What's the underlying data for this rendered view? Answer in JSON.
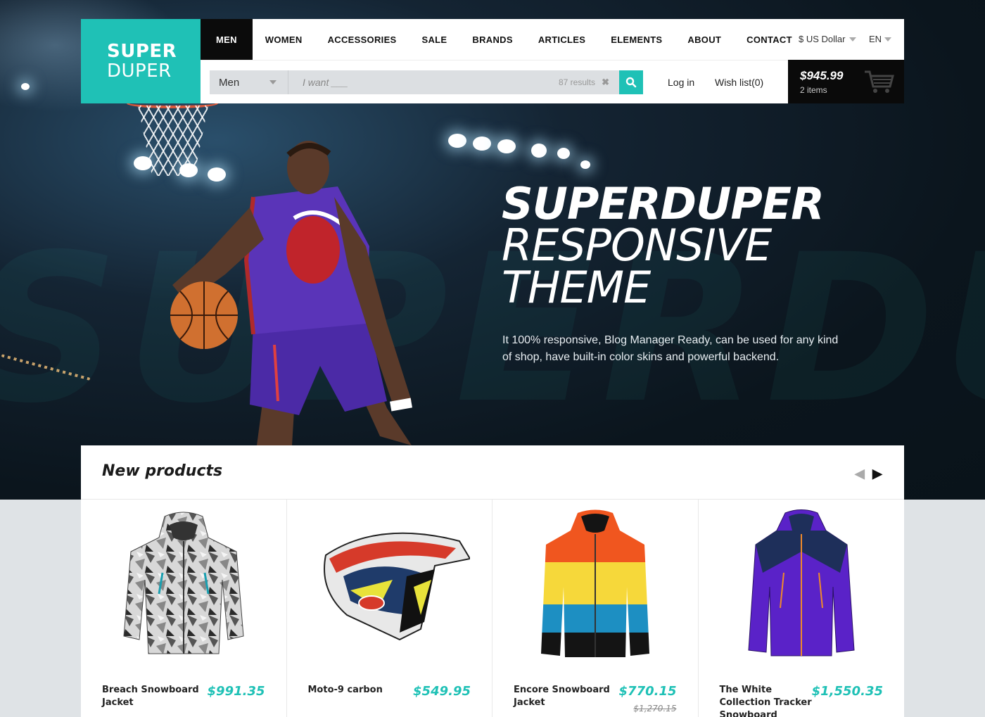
{
  "brand": {
    "line1": "SUPER",
    "line2": "DUPER"
  },
  "nav": {
    "items": [
      "MEN",
      "WOMEN",
      "ACCESSORIES",
      "SALE",
      "BRANDS",
      "ARTICLES",
      "ELEMENTS",
      "ABOUT",
      "CONTACT"
    ],
    "active": "MEN"
  },
  "currency": {
    "label": "$ US Dollar"
  },
  "language": {
    "label": "EN"
  },
  "search": {
    "category": "Men",
    "placeholder": "I want ___",
    "results": "87 results"
  },
  "account": {
    "login": "Log in",
    "wishlist": "Wish list(0)"
  },
  "cart": {
    "total": "$945.99",
    "items": "2 items"
  },
  "hero": {
    "line1": "SUPERDUPER",
    "line2": "RESPONSIVE",
    "line3": "THEME",
    "description": "It 100% responsive, Blog Manager Ready, can be used for any kind of shop, have built-in color skins and powerful backend.",
    "watermark": "SUPERDUPER"
  },
  "products": {
    "title": "New products",
    "items": [
      {
        "name": "Breach Snowboard Jacket",
        "price": "$991.35",
        "old_price": ""
      },
      {
        "name": "Moto-9 carbon",
        "price": "$549.95",
        "old_price": ""
      },
      {
        "name": "Encore Snowboard Jacket",
        "price": "$770.15",
        "old_price": "$1,270.15"
      },
      {
        "name": "The White Collection Tracker Snowboard",
        "price": "$1,550.35",
        "old_price": ""
      }
    ]
  },
  "colors": {
    "accent": "#1fc1b6",
    "dark": "#0a0a0a"
  }
}
